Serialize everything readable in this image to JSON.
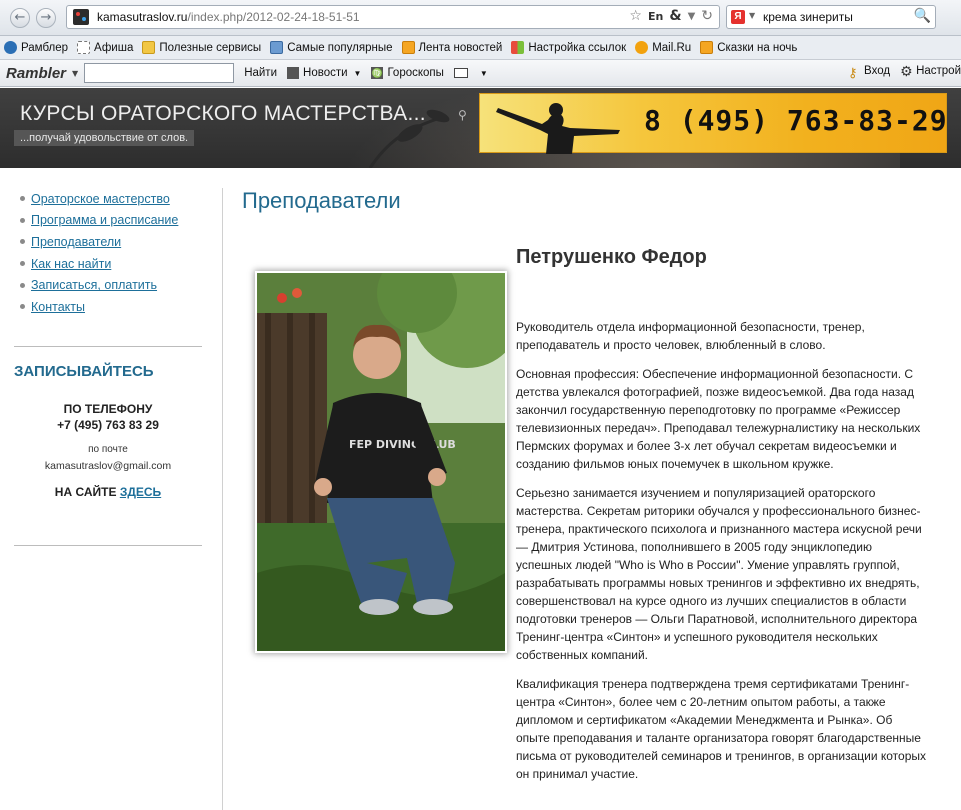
{
  "browser": {
    "url_host": "kamasutraslov.ru",
    "url_path": "/index.php/2012-02-24-18-51-51",
    "search_query": "крема зинериты",
    "search_engine": "Я"
  },
  "bookmarks": [
    {
      "label": "Рамблер",
      "icon": "rambler-icon"
    },
    {
      "label": "Афиша",
      "icon": "page-icon"
    },
    {
      "label": "Полезные сервисы",
      "icon": "folder-icon"
    },
    {
      "label": "Самые популярные",
      "icon": "star-page-icon"
    },
    {
      "label": "Лента новостей",
      "icon": "rss-icon"
    },
    {
      "label": "Настройка ссылок",
      "icon": "windows-icon"
    },
    {
      "label": "Mail.Ru",
      "icon": "at-icon"
    },
    {
      "label": "Сказки на ночь",
      "icon": "rss-icon"
    }
  ],
  "rambler_toolbar": {
    "logo": "Rambler",
    "search_button": "Найти",
    "news": "Новости",
    "horoscopes": "Гороскопы",
    "login": "Вход",
    "settings": "Настрой"
  },
  "site": {
    "title": "КУРСЫ ОРАТОРСКОГО МАСТЕРСТВА...",
    "tagline": "...получай удовольствие от слов.",
    "banner_phone": "8 (495) 763-83-29"
  },
  "sidebar": {
    "nav": [
      "Ораторское мастерство",
      "Программа и расписание",
      "Преподаватели",
      "Как нас найти",
      "Записаться, оплатить",
      "Контакты"
    ],
    "signup_title": "ЗАПИСЫВАЙТЕСЬ",
    "by_phone_label": "ПО ТЕЛЕФОНУ",
    "phone": "+7 (495) 763 83 29",
    "by_mail_label": "по почте",
    "email": "kamasutraslov@gmail.com",
    "on_site_label": "НА САЙТЕ",
    "on_site_link": "ЗДЕСЬ"
  },
  "main": {
    "page_title": "Преподаватели",
    "person_name": "Петрушенко Федор",
    "paragraphs": [
      "Руководитель отдела информационной безопасности, тренер, преподаватель и просто человек, влюбленный в слово.",
      "Основная профессия: Обеспечение информационной безопасности. С детства увлекался фотографией, позже видеосъемкой. Два года назад закончил государственную переподготовку по программе «Режиссер телевизионных передач». Преподавал тележурналистику на нескольких Пермских форумах и более 3-х лет обучал секретам видеосъемки и созданию фильмов юных почемучек в школьном кружке.",
      "Серьезно занимается изучением и популяризацией ораторского мастерства. Секретам риторики обучался у профессионального бизнес-тренера, практического психолога и признанного мастера искусной речи — Дмитрия Устинова, пополнившего в 2005 году энциклопедию успешных людей \"Who is Who в России\". Умение управлять группой, разрабатывать программы новых тренингов и эффективно их внедрять, совершенствовал на курсе одного из лучших специалистов в области подготовки тренеров — Ольги Паратновой, исполнительного директора Тренинг-центра «Синтон» и успешного руководителя нескольких собственных компаний.",
      "Квалификация тренера подтверждена тремя сертификатами Тренинг-центра «Синтон», более чем с 20-летним опытом работы, а также дипломом и сертификатом «Академии Менеджмента и Рынка». Об опыте преподавания и таланте организатора говорят благодарственные письма от руководителей семинаров и тренингов, в организации которых он принимал участие."
    ],
    "photo_shirt_text": "FEP DIVING CLUB"
  }
}
